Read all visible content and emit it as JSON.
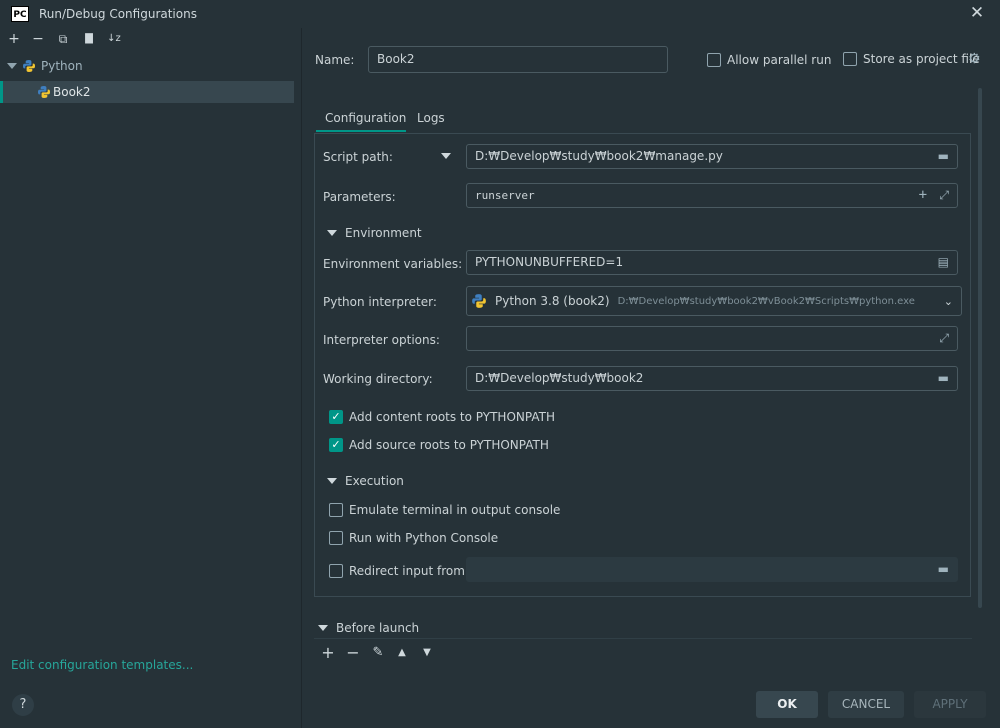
{
  "window": {
    "title": "Run/Debug Configurations",
    "logo": "PC",
    "close_glyph": "✕"
  },
  "toolbar": {
    "add": "+",
    "remove": "−",
    "copy": "⧉",
    "folder": "▇",
    "sort": "↓z"
  },
  "tree": {
    "group_label": "Python",
    "selected_label": "Book2"
  },
  "name_field": {
    "label": "Name:",
    "value": "Book2"
  },
  "options": {
    "allow_parallel": "Allow parallel run",
    "store_as_project_file": "Store as project file"
  },
  "tabs": [
    {
      "label": "Configuration"
    },
    {
      "label": "Logs"
    }
  ],
  "config": {
    "script_path": {
      "label": "Script path:",
      "value": "D:₩Develop₩study₩book2₩manage.py"
    },
    "parameters": {
      "label": "Parameters:",
      "value": "runserver"
    },
    "environment_section": "Environment",
    "env_vars": {
      "label": "Environment variables:",
      "value": "PYTHONUNBUFFERED=1"
    },
    "interpreter": {
      "label": "Python interpreter:",
      "name": "Python 3.8 (book2)",
      "path": "D:₩Develop₩study₩book2₩vBook2₩Scripts₩python.exe"
    },
    "interpreter_options": {
      "label": "Interpreter options:",
      "value": ""
    },
    "working_dir": {
      "label": "Working directory:",
      "value": "D:₩Develop₩study₩book2"
    },
    "add_content_roots": {
      "label": "Add content roots to PYTHONPATH",
      "checked": true
    },
    "add_source_roots": {
      "label": "Add source roots to PYTHONPATH",
      "checked": true
    },
    "execution_section": "Execution",
    "emulate_terminal": {
      "label": "Emulate terminal in output console",
      "checked": false
    },
    "run_python_console": {
      "label": "Run with Python Console",
      "checked": false
    },
    "redirect_input": {
      "label": "Redirect input from:",
      "checked": false,
      "value": ""
    }
  },
  "before_launch": {
    "label": "Before launch"
  },
  "footer": {
    "edit_templates": "Edit configuration templates...",
    "help": "?",
    "ok": "OK",
    "cancel": "CANCEL",
    "apply": "APPLY"
  },
  "colors": {
    "background": "#263238",
    "accent": "#009688",
    "link": "#26a69a",
    "selection": "#37474f"
  }
}
